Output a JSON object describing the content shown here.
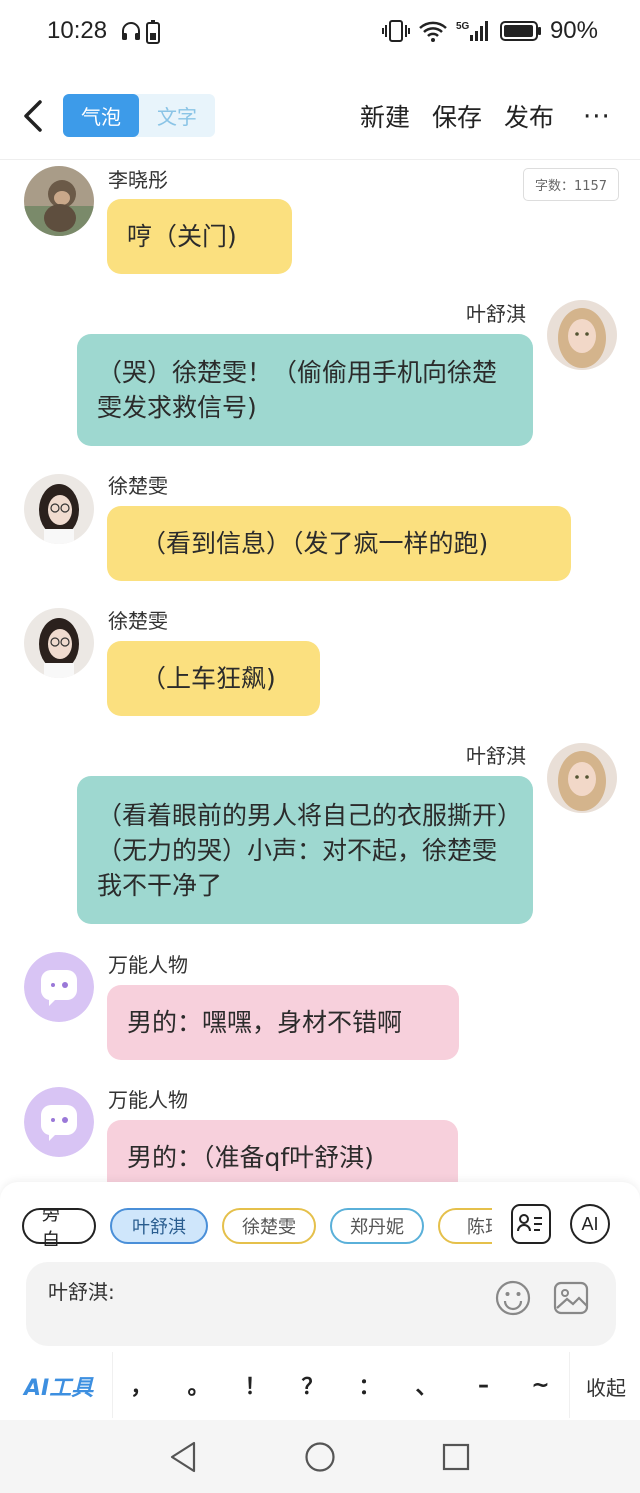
{
  "status_bar": {
    "time": "10:28",
    "battery": "90%",
    "network": "5G"
  },
  "nav": {
    "tabs": [
      "气泡",
      "文字"
    ],
    "active_tab": 0,
    "actions": [
      "新建",
      "保存",
      "发布"
    ],
    "more": "···"
  },
  "word_count": "字数：1157",
  "messages": [
    {
      "name": "李晓彤",
      "text": "哼（关门)",
      "side": "left",
      "color": "yellow",
      "avatar": "monkey"
    },
    {
      "name": "叶舒淇",
      "text": "（哭）徐楚雯！（偷偷用手机向徐楚雯发求救信号)",
      "side": "right",
      "color": "teal",
      "avatar": "girl-blonde"
    },
    {
      "name": "徐楚雯",
      "text": "（看到信息）（发了疯一样的跑)",
      "side": "left",
      "color": "yellow",
      "avatar": "girl-glasses"
    },
    {
      "name": "徐楚雯",
      "text": "（上车狂飙)",
      "side": "left",
      "color": "yellow",
      "avatar": "girl-glasses"
    },
    {
      "name": "叶舒淇",
      "text": "（看着眼前的男人将自己的衣服撕开）（无力的哭）小声：对不起，徐楚雯我不干净了",
      "side": "right",
      "color": "teal",
      "avatar": "girl-blonde"
    },
    {
      "name": "万能人物",
      "text": "男的：嘿嘿，身材不错啊",
      "side": "left",
      "color": "pink",
      "avatar": "purple-chat"
    },
    {
      "name": "万能人物",
      "text": "男的：（准备qf叶舒淇)",
      "side": "left",
      "color": "pink",
      "avatar": "purple-chat"
    }
  ],
  "roles": [
    "旁白",
    "叶舒淇",
    "徐楚雯",
    "郑丹妮",
    "陈珂"
  ],
  "selected_role": 1,
  "ai_button": "AI",
  "input": {
    "prefix": "叶舒淇:"
  },
  "toolbar": {
    "ai_tool": "AI工具",
    "punctuation": [
      "，",
      "。",
      "！",
      "？",
      "：",
      "、",
      "–",
      "~"
    ],
    "collapse": "收起"
  },
  "colors": {
    "accent": "#3d9be9",
    "yellow": "#fbe07f",
    "teal": "#9ed8d0",
    "pink": "#f7d0dc"
  }
}
